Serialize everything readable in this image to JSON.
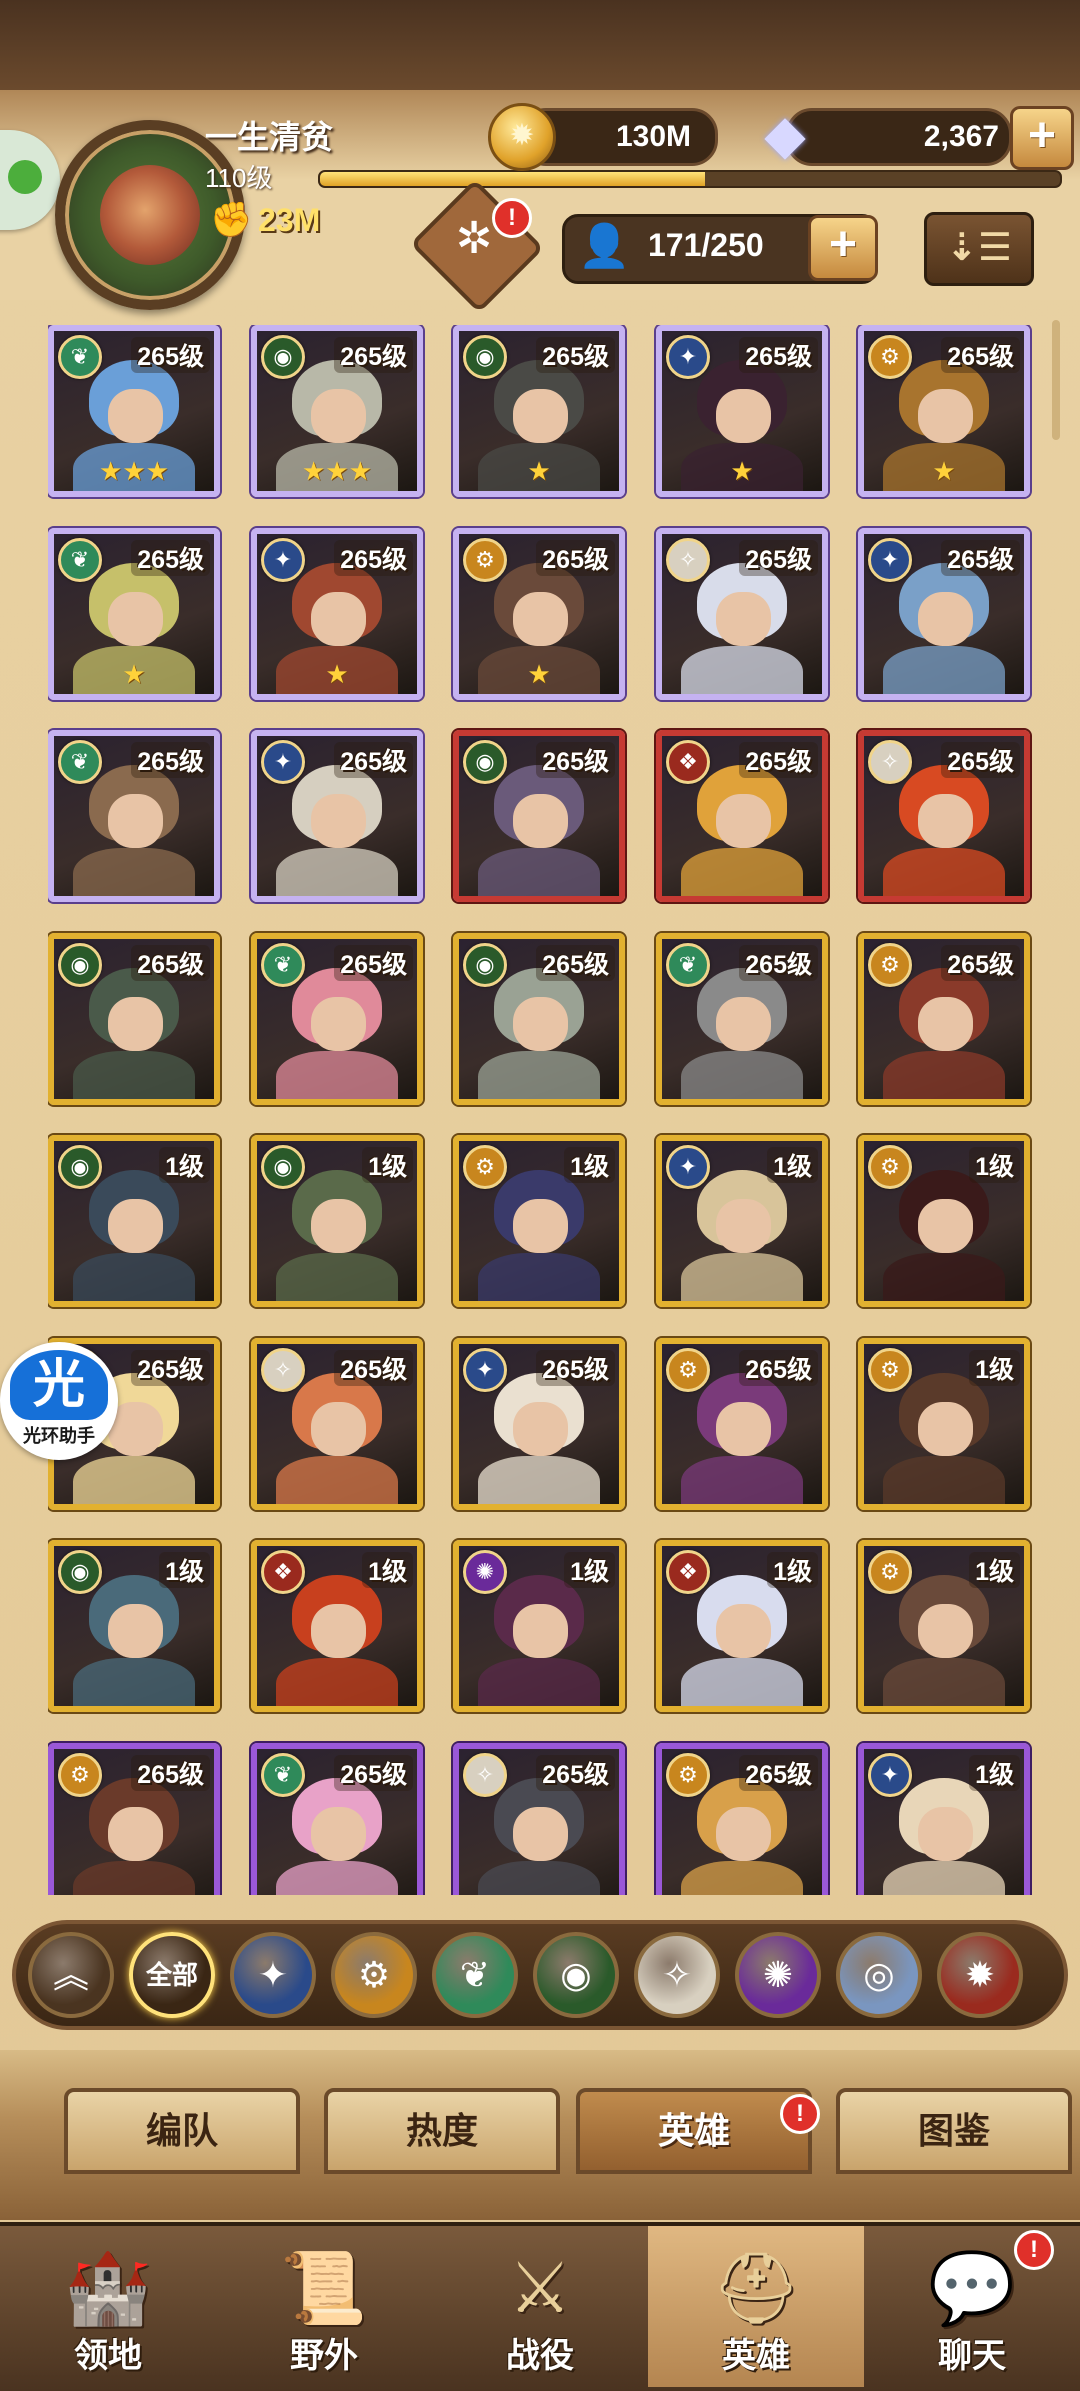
{
  "player": {
    "name": "一生清贫",
    "level": "110级",
    "xp_fraction": 0.52,
    "power": "23M"
  },
  "resources": {
    "gold": "130M",
    "gems": "2,367"
  },
  "heroes_capacity": "171/250",
  "notification_mark": "!",
  "heroes": [
    {
      "level": "265级",
      "stars": "★★★",
      "frame": "purple",
      "faction": "wilder",
      "color": "#6a9fd8"
    },
    {
      "level": "265级",
      "stars": "★★★",
      "frame": "purple",
      "faction": "graveborn",
      "color": "#b8b8a8"
    },
    {
      "level": "265级",
      "stars": "★",
      "frame": "purple",
      "faction": "graveborn",
      "color": "#4a4a46"
    },
    {
      "level": "265级",
      "stars": "★",
      "frame": "purple",
      "faction": "lightbearer",
      "color": "#3a2230"
    },
    {
      "level": "265级",
      "stars": "★",
      "frame": "purple",
      "faction": "mauler",
      "color": "#a8742e"
    },
    {
      "level": "265级",
      "stars": "★",
      "frame": "purple",
      "faction": "wilder",
      "color": "#c6c06a"
    },
    {
      "level": "265级",
      "stars": "★",
      "frame": "purple",
      "faction": "lightbearer",
      "color": "#a04830"
    },
    {
      "level": "265级",
      "stars": "★",
      "frame": "purple",
      "faction": "mauler",
      "color": "#6a4a3a"
    },
    {
      "level": "265级",
      "stars": "",
      "frame": "purple",
      "faction": "celestial",
      "color": "#d8dcea"
    },
    {
      "level": "265级",
      "stars": "",
      "frame": "purple",
      "faction": "lightbearer",
      "color": "#7aa0c8"
    },
    {
      "level": "265级",
      "stars": "",
      "frame": "purple",
      "faction": "wilder",
      "color": "#8a6a4e"
    },
    {
      "level": "265级",
      "stars": "",
      "frame": "purple",
      "faction": "lightbearer",
      "color": "#d6cfc0"
    },
    {
      "level": "265级",
      "stars": "",
      "frame": "red",
      "faction": "graveborn",
      "color": "#6a5a7a"
    },
    {
      "level": "265级",
      "stars": "",
      "frame": "red",
      "faction": "dimensional",
      "color": "#e0a23a"
    },
    {
      "level": "265级",
      "stars": "",
      "frame": "red",
      "faction": "celestial",
      "color": "#d84a22"
    },
    {
      "level": "265级",
      "stars": "",
      "frame": "gold",
      "faction": "graveborn",
      "color": "#4a5a4a"
    },
    {
      "level": "265级",
      "stars": "",
      "frame": "gold",
      "faction": "wilder",
      "color": "#e08a9a"
    },
    {
      "level": "265级",
      "stars": "",
      "frame": "gold",
      "faction": "graveborn",
      "color": "#9aa294"
    },
    {
      "level": "265级",
      "stars": "",
      "frame": "gold",
      "faction": "wilder",
      "color": "#8a8a8a"
    },
    {
      "level": "265级",
      "stars": "",
      "frame": "gold",
      "faction": "mauler",
      "color": "#8a3a2a"
    },
    {
      "level": "1级",
      "stars": "",
      "frame": "gold",
      "faction": "graveborn",
      "color": "#3a4a5a"
    },
    {
      "level": "1级",
      "stars": "",
      "frame": "gold",
      "faction": "graveborn",
      "color": "#5a6a4a"
    },
    {
      "level": "1级",
      "stars": "",
      "frame": "gold",
      "faction": "mauler",
      "color": "#3a3a6a"
    },
    {
      "level": "1级",
      "stars": "",
      "frame": "gold",
      "faction": "lightbearer",
      "color": "#d8c49a"
    },
    {
      "level": "1级",
      "stars": "",
      "frame": "gold",
      "faction": "mauler",
      "color": "#3a1a1a"
    },
    {
      "level": "265级",
      "stars": "",
      "frame": "gold",
      "faction": "lightbearer",
      "color": "#f0d898"
    },
    {
      "level": "265级",
      "stars": "",
      "frame": "gold",
      "faction": "celestial",
      "color": "#d8784a"
    },
    {
      "level": "265级",
      "stars": "",
      "frame": "gold",
      "faction": "lightbearer",
      "color": "#eae0d0"
    },
    {
      "level": "265级",
      "stars": "",
      "frame": "gold",
      "faction": "mauler",
      "color": "#7a3a7a"
    },
    {
      "level": "1级",
      "stars": "",
      "frame": "gold",
      "faction": "mauler",
      "color": "#5a3a2a"
    },
    {
      "level": "1级",
      "stars": "",
      "frame": "gold",
      "faction": "graveborn",
      "color": "#4a6a7a"
    },
    {
      "level": "1级",
      "stars": "",
      "frame": "gold",
      "faction": "dimensional",
      "color": "#c8401e"
    },
    {
      "level": "1级",
      "stars": "",
      "frame": "gold",
      "faction": "hypogean",
      "color": "#5a2a4a"
    },
    {
      "level": "1级",
      "stars": "",
      "frame": "gold",
      "faction": "dimensional",
      "color": "#d8dcee"
    },
    {
      "level": "1级",
      "stars": "",
      "frame": "gold",
      "faction": "mauler",
      "color": "#6a4a3a"
    },
    {
      "level": "265级",
      "stars": "",
      "frame": "violet",
      "faction": "mauler",
      "color": "#6a3a2a"
    },
    {
      "level": "265级",
      "stars": "",
      "frame": "violet",
      "faction": "wilder",
      "color": "#e8a2c8"
    },
    {
      "level": "265级",
      "stars": "",
      "frame": "violet",
      "faction": "celestial",
      "color": "#4a4a52"
    },
    {
      "level": "265级",
      "stars": "",
      "frame": "violet",
      "faction": "mauler",
      "color": "#d8a04a"
    },
    {
      "level": "1级",
      "stars": "",
      "frame": "violet",
      "faction": "lightbearer",
      "color": "#e8d6b8"
    }
  ],
  "faction_colors": {
    "lightbearer": "#2a4a8a",
    "mauler": "#c8861e",
    "wilder": "#2f8a5a",
    "graveborn": "#2a5a2a",
    "celestial": "#d8d0c0",
    "hypogean": "#6a2a9a",
    "dimensional": "#9a2a1e"
  },
  "filters": [
    {
      "label": "",
      "icon": "collapse-icon",
      "color": "#4a3420"
    },
    {
      "label": "全部",
      "icon": "all-icon",
      "color": "#3a2614",
      "active": true
    },
    {
      "label": "",
      "icon": "lightbearer-icon",
      "color": "#2a4a8a"
    },
    {
      "label": "",
      "icon": "mauler-icon",
      "color": "#c8861e"
    },
    {
      "label": "",
      "icon": "wilder-icon",
      "color": "#2f8a5a"
    },
    {
      "label": "",
      "icon": "graveborn-icon",
      "color": "#2a5a2a"
    },
    {
      "label": "",
      "icon": "celestial-icon",
      "color": "#d8d0c0"
    },
    {
      "label": "",
      "icon": "hypogean-icon",
      "color": "#6a2a9a"
    },
    {
      "label": "",
      "icon": "dimensional-icon",
      "color": "#7a96c0"
    },
    {
      "label": "",
      "icon": "dimensional-fire-icon",
      "color": "#9a2a1e"
    }
  ],
  "subtabs": [
    "编队",
    "热度",
    "英雄",
    "图鉴"
  ],
  "nav": [
    "领地",
    "野外",
    "战役",
    "英雄",
    "聊天"
  ],
  "assistant": {
    "glyph": "光",
    "label": "光环助手"
  }
}
